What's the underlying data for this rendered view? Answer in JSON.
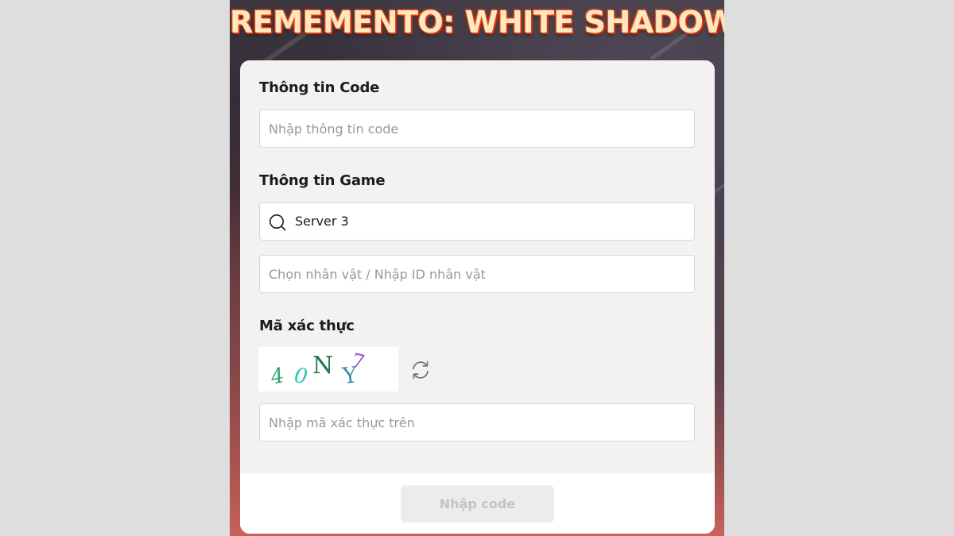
{
  "header": {
    "title": "REMEMENTO: WHITE SHADOW"
  },
  "code_section": {
    "title": "Thông tin Code",
    "code_input_placeholder": "Nhập thông tin code",
    "code_input_value": ""
  },
  "game_section": {
    "title": "Thông tin Game",
    "server_value": "Server 3",
    "server_icon": "search-icon",
    "character_input_placeholder": "Chọn nhân vật / Nhập ID nhân vật",
    "character_input_value": ""
  },
  "captcha_section": {
    "title": "Mã xác thực",
    "captcha_text": "40NY7",
    "refresh_icon": "refresh-icon",
    "captcha_input_placeholder": "Nhập mã xác thực trên",
    "captcha_input_value": ""
  },
  "footer": {
    "submit_label": "Nhập code"
  },
  "colors": {
    "card_bg": "#f3f2f1",
    "title_glow": "#ff5a1a",
    "text_dark": "#1b1b24",
    "submit_disabled_bg": "#ececec",
    "submit_disabled_text": "#c3c3c3"
  }
}
